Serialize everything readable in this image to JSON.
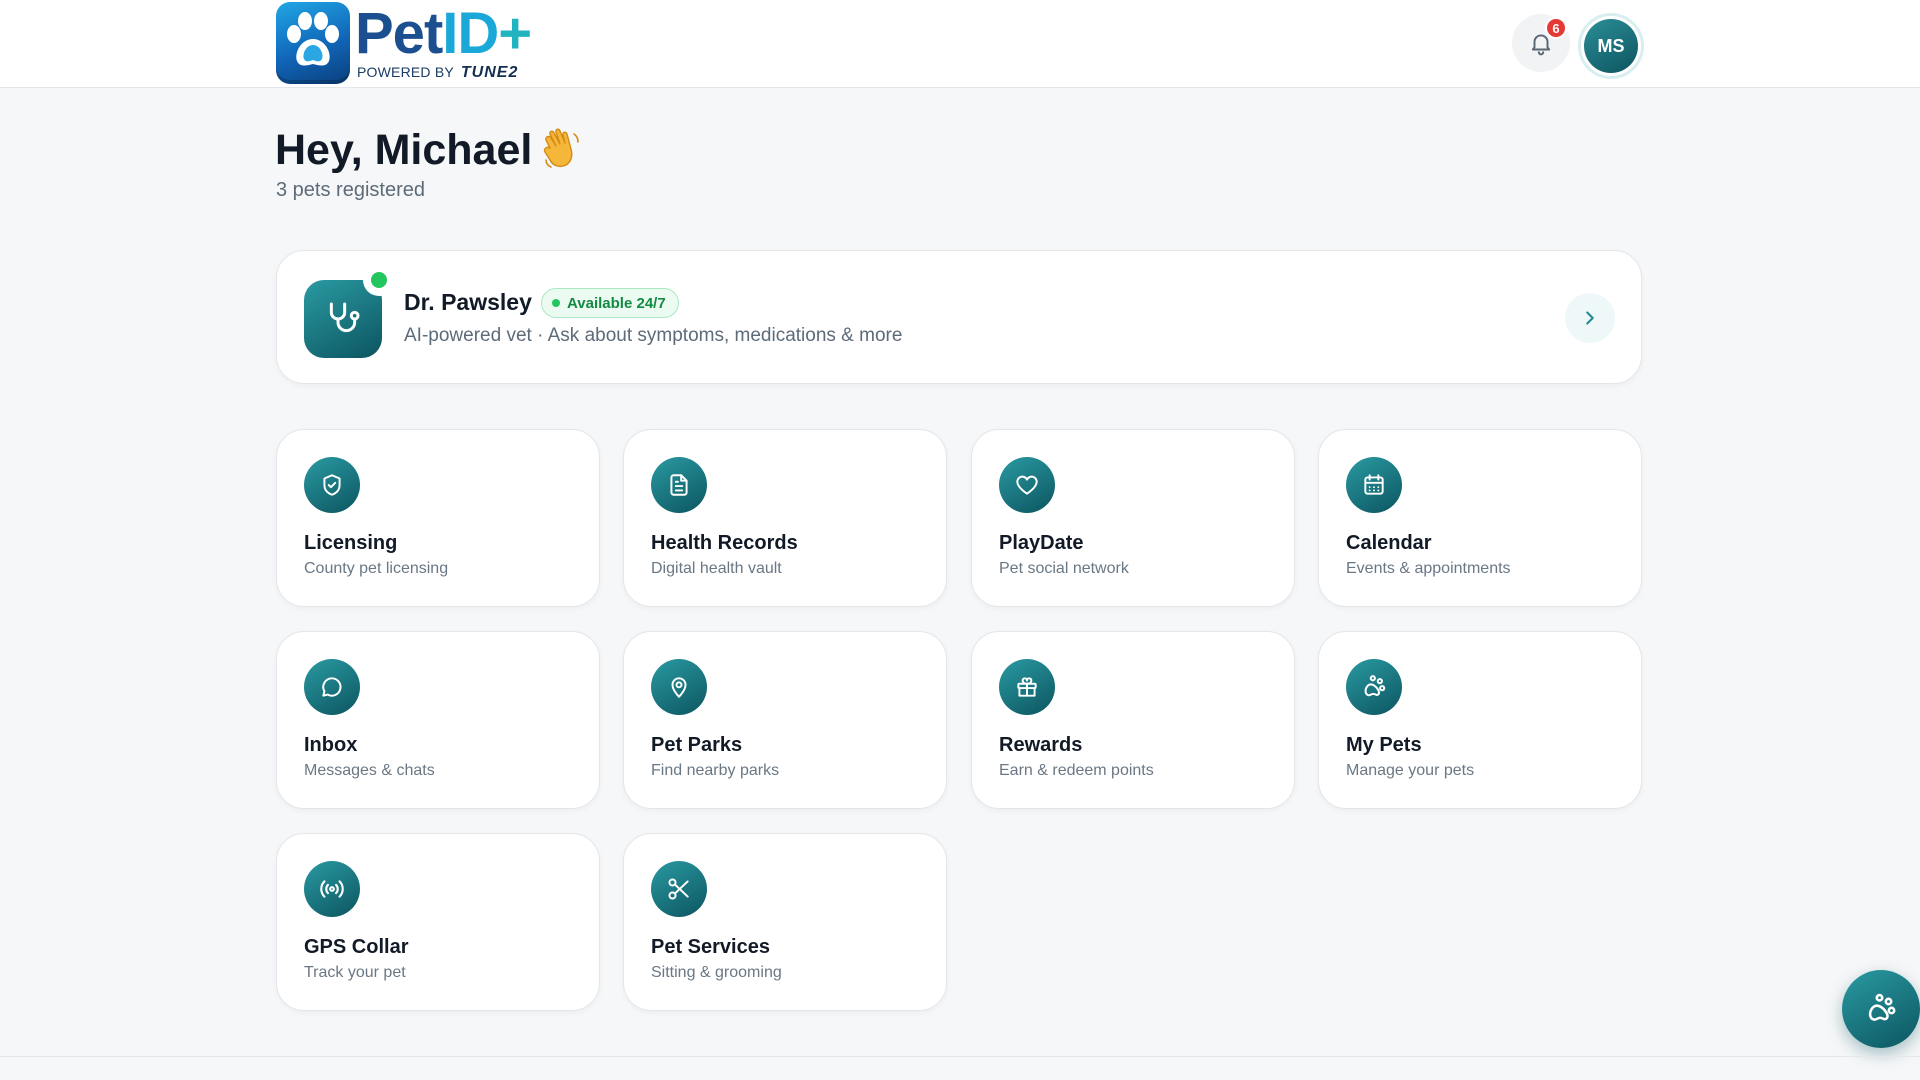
{
  "header": {
    "logo": {
      "word_a": "Pet",
      "word_b": "ID",
      "word_c": "+",
      "powered_by": "POWERED BY",
      "brand": "TUNE2"
    },
    "notifications_count": "6",
    "avatar_initials": "MS"
  },
  "greeting": {
    "title": "Hey, Michael",
    "emoji": "👋",
    "subtitle": "3 pets registered"
  },
  "vet": {
    "name": "Dr. Pawsley",
    "badge": "Available 24/7",
    "description": "AI-powered vet · Ask about symptoms, medications & more"
  },
  "tiles": [
    {
      "title": "Licensing",
      "subtitle": "County pet licensing",
      "icon": "shield-check-icon"
    },
    {
      "title": "Health Records",
      "subtitle": "Digital health vault",
      "icon": "document-icon"
    },
    {
      "title": "PlayDate",
      "subtitle": "Pet social network",
      "icon": "heart-icon"
    },
    {
      "title": "Calendar",
      "subtitle": "Events & appointments",
      "icon": "calendar-icon"
    },
    {
      "title": "Inbox",
      "subtitle": "Messages & chats",
      "icon": "chat-bubble-icon"
    },
    {
      "title": "Pet Parks",
      "subtitle": "Find nearby parks",
      "icon": "map-pin-icon"
    },
    {
      "title": "Rewards",
      "subtitle": "Earn & redeem points",
      "icon": "gift-icon"
    },
    {
      "title": "My Pets",
      "subtitle": "Manage your pets",
      "icon": "paw-icon"
    },
    {
      "title": "GPS Collar",
      "subtitle": "Track your pet",
      "icon": "radio-signal-icon"
    },
    {
      "title": "Pet Services",
      "subtitle": "Sitting & grooming",
      "icon": "scissors-icon"
    }
  ],
  "colors": {
    "accent_teal": "#0c5560",
    "accent_teal_light": "#2a9aa2",
    "online_green": "#22c55e",
    "badge_red": "#e53935"
  }
}
